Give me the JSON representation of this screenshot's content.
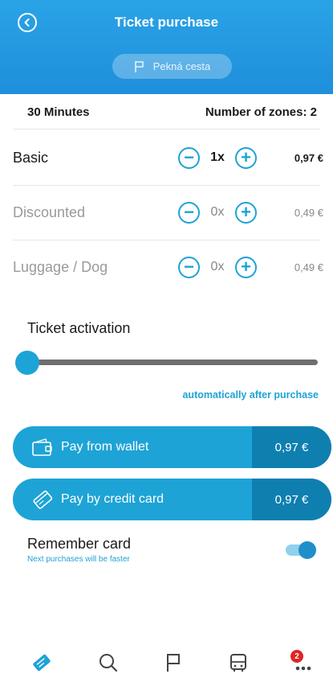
{
  "header": {
    "title": "Ticket purchase",
    "route_name": "Pekná cesta"
  },
  "summary": {
    "duration": "30 Minutes",
    "zones": "Number of zones: 2"
  },
  "tickets": [
    {
      "name": "Basic",
      "quantity": "1x",
      "price": "0,97 €",
      "active": true
    },
    {
      "name": "Discounted",
      "quantity": "0x",
      "price": "0,49 €",
      "active": false
    },
    {
      "name": "Luggage / Dog",
      "quantity": "0x",
      "price": "0,49 €",
      "active": false
    }
  ],
  "activation": {
    "title": "Ticket activation",
    "note": "automatically after purchase",
    "slider_value": 0
  },
  "payment": {
    "wallet_label": "Pay from wallet",
    "wallet_amount": "0,97 €",
    "card_label": "Pay by credit card",
    "card_amount": "0,97 €"
  },
  "remember": {
    "title": "Remember card",
    "subtitle": "Next purchases will be faster",
    "enabled": true
  },
  "nav": {
    "items": [
      "tickets-icon",
      "search-icon",
      "flag-icon",
      "bus-icon",
      "more-icon"
    ],
    "badge_count": "2"
  },
  "colors": {
    "accent": "#1ea3d6",
    "accent_dark": "#0f7fb0",
    "header": "#2aa3e6",
    "badge": "#e02424"
  }
}
